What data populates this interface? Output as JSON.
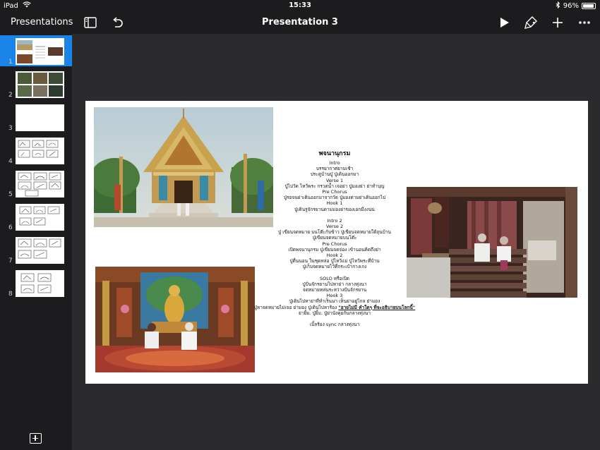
{
  "status": {
    "device": "iPad",
    "time": "15:33",
    "battery": "96%",
    "battery_level": 0.96
  },
  "toolbar": {
    "back_label": "Presentations",
    "title": "Presentation 3",
    "icons": [
      "sidebar-icon",
      "undo-icon",
      "play-icon",
      "format-brush-icon",
      "add-icon",
      "more-icon"
    ]
  },
  "sidebar": {
    "slides": [
      {
        "number": "1",
        "selected": true
      },
      {
        "number": "2",
        "selected": false
      },
      {
        "number": "3",
        "selected": false
      },
      {
        "number": "4",
        "selected": false
      },
      {
        "number": "5",
        "selected": false
      },
      {
        "number": "6",
        "selected": false
      },
      {
        "number": "7",
        "selected": false
      },
      {
        "number": "8",
        "selected": false
      }
    ]
  },
  "slide": {
    "heading": "พจนานุกรม",
    "lines": [
      "Intro",
      "บรรยากาศยามเช้า",
      "ประตูบ้านปู่ ปู่เดินออกมา",
      "Verse 1",
      "ปู่ไปวัด ไหว้พระ กรวดน้ำ เจอย่า ปู่มองย่า ย่าทำบุญ",
      "Pre Chorus",
      "ปู่รอจนย่าเดินออกมาจากวัด ปู่มองตามย่าเดินออกไป",
      "Hook 1",
      "ปู่เดินรูจักรยานตามมองย่าของเอกมีงงนน"
    ],
    "lines2": [
      "Intro 2",
      "Verse 2",
      "ปู่ เขียนจดหมาย บนโต๊ะกับข้าว ปู่เขียนจดหมายใต้ถุนบ้าน",
      "ปู่เขียนจดหมายบนโต๊ะ",
      "Pre Chorus",
      "เปิดพจนานุกรม ปู่เขียนจดจ่อง เข้านอนคิดถึงย่า",
      "Hook 2",
      "ปู่ตื่นนอน ในชุดหล่อ ปู่ไหว้แม่ ปู่ไหว้พระที่บ้าน",
      "ปู่เก็บจดหมายไว้ที่กระเป๋ากางเกง"
    ],
    "lines3": [
      "SOLO หรือเปิด",
      "ปู่ปั่นจักรยานไปหาย่า กลางทุ่งนา",
      "จดหมายหล่นระหว่างปั่นจักรยาน",
      "Hook 3",
      "ปู่เดินไปหาย่าที่ทำเร็นนา เห็นย่าอยู่ไกล ย่ามอง"
    ],
    "line_prefix": "ปู่หาจดหมายไม่เจอ ย่ามอง ปู่เดินไปหาร้อง",
    "line_highlight": "\"อายไม่มี คำใดๆ ที่จะอธิบายบนโลกนี้\"",
    "lines4": [
      "ย่ายิ้ม. ปู่ยิ้ม. ปู่ย่านั่งคุยกันกลางทุ่งนา"
    ],
    "closing": "เบิ้ลร้อง sync กลางทุ่งนา"
  },
  "colors": {
    "accent": "#1a84e8",
    "toolbar_bg": "#1c1c1e",
    "canvas_bg": "#2b2b2d"
  }
}
